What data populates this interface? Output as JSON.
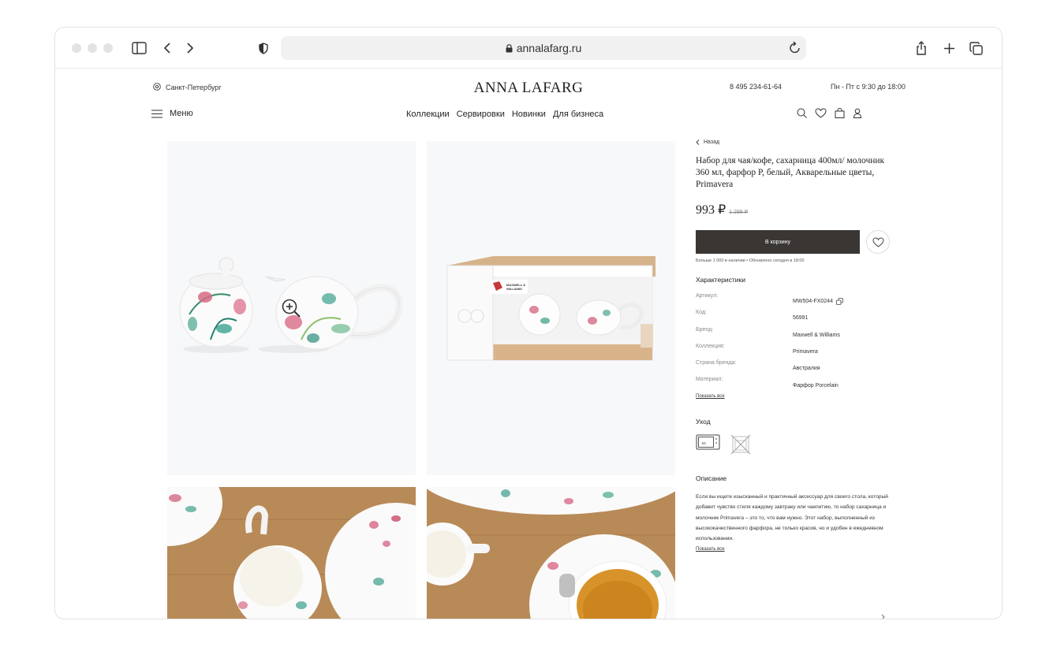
{
  "browser": {
    "url": "annalafarg.ru"
  },
  "site": {
    "city": "Санкт-Петербург",
    "logo": "ANNA LAFARG",
    "phone": "8 495 234-61-64",
    "hours": "Пн - Пт с 9:30 до 18:00",
    "menu_label": "Меню",
    "nav": [
      "Коллекции",
      "Сервировки",
      "Новинки",
      "Для бизнеса"
    ]
  },
  "product": {
    "back_label": "Назад",
    "title": "Набор для чая/кофе, сахарница 400мл/ молочник 360 мл, фарфор P, белый, Акварельные цветы, Primavera",
    "price": "993 ₽",
    "old_price": "1 299 ₽",
    "buy_label": "В корзину",
    "stock_text": "Больше 1 000 в наличии  •  Обновлено сегодня в 18:00",
    "specs_title": "Характеристики",
    "specs": [
      {
        "key": "Артикул:",
        "value": "MW504-FX0244"
      },
      {
        "key": "Код:",
        "value": "56991"
      },
      {
        "key": "Бренд:",
        "value": "Maxwell & Williams"
      },
      {
        "key": "Коллекция:",
        "value": "Primavera"
      },
      {
        "key": "Страна бренда:",
        "value": "Австралия"
      },
      {
        "key": "Материал:",
        "value": "Фарфор Porcelain"
      }
    ],
    "show_all": "Показать все",
    "care_title": "Уход",
    "care_icons": [
      "microwave-icon",
      "no-dishwasher-icon"
    ],
    "description_title": "Описание",
    "description": "Если вы ищете изысканный и практичный аксессуар для своего стола, который добавит чувство стиля каждому завтраку или чаепитию, то набор сахарница и молочник Primavera – это то, что вам нужно. Этот набор, выполненный из высококачественного фарфора, не только красив, но и удобен в ежедневном использовании.",
    "description_more": "Показать все",
    "box_text": "MAXWELL & WILLIAMS"
  },
  "colors": {
    "buy_button": "#3a3634",
    "photo_bg": "#f7f8fa",
    "wood": "#b98b5a"
  }
}
